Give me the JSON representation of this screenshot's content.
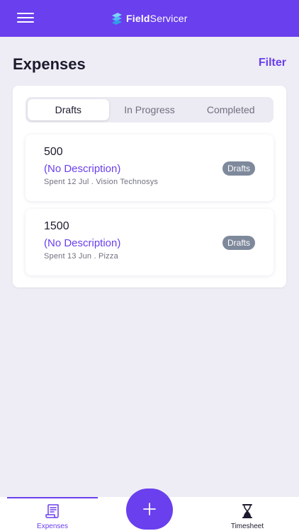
{
  "header": {
    "brand_prefix": "Field",
    "brand_suffix": "Servicer",
    "menu_icon": "hamburger-menu-icon",
    "brand_color": "#6a3fee"
  },
  "page": {
    "title": "Expenses",
    "filter_label": "Filter"
  },
  "tabs": [
    {
      "label": "Drafts",
      "active": true
    },
    {
      "label": "In Progress",
      "active": false
    },
    {
      "label": "Completed",
      "active": false
    }
  ],
  "expenses": [
    {
      "amount": "500",
      "description": "(No Description)",
      "meta": "Spent 12 Jul . Vision Technosys",
      "status": "Drafts"
    },
    {
      "amount": "1500",
      "description": "(No Description)",
      "meta": "Spent 13 Jun . Pizza",
      "status": "Drafts"
    }
  ],
  "bottom_nav": {
    "items": [
      {
        "label": "Expenses",
        "icon": "receipt-icon",
        "active": true
      },
      {
        "label": "Timesheet",
        "icon": "hourglass-icon",
        "active": false
      }
    ],
    "fab_icon": "plus-icon"
  },
  "colors": {
    "accent": "#6a3fee",
    "background": "#eeedf5",
    "badge": "#7e899c"
  }
}
